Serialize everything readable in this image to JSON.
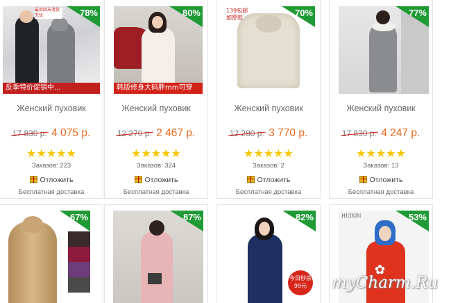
{
  "products": [
    {
      "title": "Женский пуховик",
      "discount": "78%",
      "old_price": "17 830 р.",
      "new_price": "4 075 р.",
      "rating_stars": "★★★★★",
      "orders": "Заказов: 223",
      "defer_label": "Отложить",
      "shipping": "Бесплатная доставка",
      "image_caption": "反季特价促销中...",
      "image_tag": "最后四天清货无忧"
    },
    {
      "title": "Женский пуховик",
      "discount": "80%",
      "old_price": "12 270 р.",
      "new_price": "2 467 р.",
      "rating_stars": "★★★★★",
      "orders": "Заказов: 324",
      "defer_label": "Отложить",
      "shipping": "Бесплатная доставка",
      "image_caption": "韩版修身大码胖mm可穿"
    },
    {
      "title": "Женский пуховик",
      "discount": "70%",
      "old_price": "12 280 р.",
      "new_price": "3 770 р.",
      "rating_stars": "★★★★★",
      "orders": "Заказов: 2",
      "defer_label": "Отложить",
      "shipping": "Бесплатная доставка",
      "image_tag": "139包邮 加厚款"
    },
    {
      "title": "Женский пуховик",
      "discount": "77%",
      "old_price": "17 830 р.",
      "new_price": "4 247 р.",
      "rating_stars": "★★★★★",
      "orders": "Заказов: 13",
      "defer_label": "Отложить",
      "shipping": "Бесплатная доставка"
    }
  ],
  "bottom_products": [
    {
      "discount": "67%"
    },
    {
      "discount": "87%"
    },
    {
      "discount": "82%",
      "sticker": "今日秒杀 99元"
    },
    {
      "discount": "53%",
      "brand": "HUIXIN"
    }
  ],
  "watermark": "myCharm.Ru",
  "colors": {
    "badge": "#1f9a35",
    "new_price": "#e8671a",
    "stars": "#f7c600",
    "strike": "#dd1111"
  }
}
